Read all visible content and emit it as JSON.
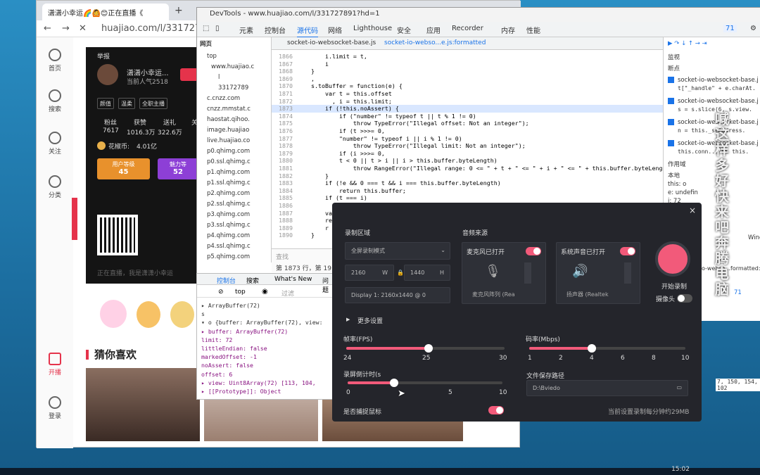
{
  "browser": {
    "tab_title": "潇潇小幸运🌈🙆😊正在直播《",
    "new_tab": "+",
    "url": "huajiao.com/l/331727"
  },
  "nav": {
    "home": "首页",
    "search": "搜索",
    "follow": "关注",
    "category": "分类",
    "live": "开播",
    "login": "登录"
  },
  "stage": {
    "report": "举报",
    "name": "潇潇小幸运...",
    "popularity": "当前人气2518",
    "chips": [
      "颜值",
      "温柔",
      "全职主播"
    ],
    "stats_labels": [
      "粉丝",
      "获赞",
      "送礼",
      "关"
    ],
    "stats_values": [
      "7617",
      "1016.3万",
      "322.6万"
    ],
    "coins": "花椒币:",
    "coins_value": "4.01亿",
    "level_label": "用户等级",
    "level_value": "45",
    "charm_label": "魅力等",
    "charm_value": "52",
    "chat_placeholder": "正在直播，我是潇潇小幸运"
  },
  "guess": "猜你喜欢",
  "devtools": {
    "title": "DevTools - www.huajiao.com/l/331727891?hd=1",
    "tabs": [
      "元素",
      "控制台",
      "源代码",
      "网络",
      "Lighthouse",
      "安全",
      "应用",
      "Recorder",
      "内存",
      "性能"
    ],
    "issues": "71",
    "pane_tabs": [
      "网页"
    ],
    "tree": [
      "top",
      "www.huajiao.c",
      "l",
      "33172789",
      "c.cnzz.com",
      "cnzz.mmstat.c",
      "haostat.qihoo.",
      "image.huajiao",
      "live.huajiao.co",
      "p0.qhimg.com",
      "p0.ssl.qhimg.c",
      "p1.qhimg.com",
      "p1.ssl.qhimg.c",
      "p2.qhimg.com",
      "p2.ssl.qhimg.c",
      "p3.qhimg.com",
      "p3.ssl.qhimg.c",
      "p4.qhimg.com",
      "p4.ssl.qhimg.c",
      "p5.qhimg.com"
    ],
    "editor_tabs": [
      "socket-io-websocket-base.js",
      "socket-io-webso...e.js:formatted"
    ],
    "code": [
      {
        "n": "1866",
        "t": "        i.limit = t,"
      },
      {
        "n": "1867",
        "t": "        i"
      },
      {
        "n": "1868",
        "t": "    }"
      },
      {
        "n": "1869",
        "t": "    ,"
      },
      {
        "n": "1870",
        "t": "    s.toBuffer = function(e) {"
      },
      {
        "n": "1871",
        "t": "        var t = this.offset"
      },
      {
        "n": "1872",
        "t": "          , i = this.limit;"
      },
      {
        "n": "1873",
        "t": "        if (!this.noAssert) {"
      },
      {
        "n": "1874",
        "t": "            if (\"number\" != typeof t || t % 1 != 0)"
      },
      {
        "n": "1875",
        "t": "                throw TypeError(\"Illegal offset: Not an integer\");"
      },
      {
        "n": "1876",
        "t": "            if (t >>>= 0,"
      },
      {
        "n": "1877",
        "t": "            \"number\" != typeof i || i % 1 != 0)"
      },
      {
        "n": "1878",
        "t": "                throw TypeError(\"Illegal limit: Not an integer\");"
      },
      {
        "n": "1879",
        "t": "            if (i >>>= 0,"
      },
      {
        "n": "1880",
        "t": "            t < 0 || t > i || i > this.buffer.byteLength)"
      },
      {
        "n": "1881",
        "t": "                throw RangeError(\"Illegal range: 0 <= \" + t + \" <= \" + i + \" <= \" + this.buffer.byteLength"
      },
      {
        "n": "1882",
        "t": "        }"
      },
      {
        "n": "1883",
        "t": "        if (!e && 0 === t && i === this.buffer.byteLength)"
      },
      {
        "n": "1884",
        "t": "            return this.buffer;"
      },
      {
        "n": "1885",
        "t": "        if (t === i)"
      },
      {
        "n": "1886",
        "t": "            return n;"
      },
      {
        "n": "1887",
        "t": "        var"
      },
      {
        "n": "1888",
        "t": "        ret"
      },
      {
        "n": "1889",
        "t": "        r"
      },
      {
        "n": "1890",
        "t": "    }"
      }
    ],
    "search_placeholder": "查找",
    "position": "第 1873 行，第 19 列",
    "right": {
      "watch": "监视",
      "breakpoints": "断点",
      "bp": [
        {
          "f": "socket-io-websocket-base.j",
          "c": "t[\"_handle\" + e.charAt."
        },
        {
          "f": "socket-io-websocket-base.j",
          "c": "s = s.slice(6, s.view."
        },
        {
          "f": "socket-io-websocket-base.j",
          "c": "n = this._seAddress."
        },
        {
          "f": "socket-io-websocket-base.j",
          "c": "this.conn... && this."
        }
      ],
      "scope": "作用域",
      "local": "本地",
      "vars": [
        "this: o",
        "e: undefin",
        "i: 72"
      ],
      "window_label": "Wind",
      "file_footer": "o-webso...formatted:",
      "count": "71",
      "array_tail": "7, 150, 154, 102"
    }
  },
  "console": {
    "tabs": [
      "控制台",
      "搜索",
      "What's New",
      "问题"
    ],
    "context": "top",
    "filter": "过滤",
    "lines": [
      "▸ ArrayBuffer(72)",
      "s",
      "▾ o {buffer: ArrayBuffer(72), view:",
      "  ▸ buffer: ArrayBuffer(72)",
      "    limit: 72",
      "    littleEndian: false",
      "    markedOffset: -1",
      "    noAssert: false",
      "    offset: 6",
      "  ▸ view: Uint8Array(72) [113, 104,",
      "  ▸ [[Prototype]]: Object"
    ]
  },
  "recorder": {
    "area_label": "录制区域",
    "area_mode": "全屏录制模式",
    "width": "2160",
    "w": "W",
    "height": "1440",
    "h": "H",
    "display": "Display 1: 2160x1440 @ 0",
    "audio_label": "音频来源",
    "mic_label": "麦克风已打开",
    "mic_device": "麦克风阵列 (Rea",
    "sys_label": "系统声音已打开",
    "sys_device": "扬声器 (Realtek",
    "start": "开始录制",
    "camera": "摄像头",
    "more": "更多设置",
    "fps_label": "帧率(FPS)",
    "fps_ticks": [
      "24",
      "25",
      "30"
    ],
    "fps_value": 25,
    "bitrate_label": "码率(Mbps)",
    "bitrate_ticks": [
      "1",
      "2",
      "4",
      "6",
      "8",
      "10"
    ],
    "bitrate_value": 4,
    "countdown_label": "录屏倒计时(s",
    "countdown_ticks": [
      "0",
      "5",
      "10"
    ],
    "countdown_value": 3,
    "path_label": "文件保存路径",
    "path": "D:\\Bviedo",
    "capture_mouse": "是否捕捉鼠标",
    "estimate": "当前设置录制每分钟约29MB",
    "close": "×"
  },
  "overlay_text": "喊这样多好快来吧奔腾电脑",
  "clock": "15:02"
}
